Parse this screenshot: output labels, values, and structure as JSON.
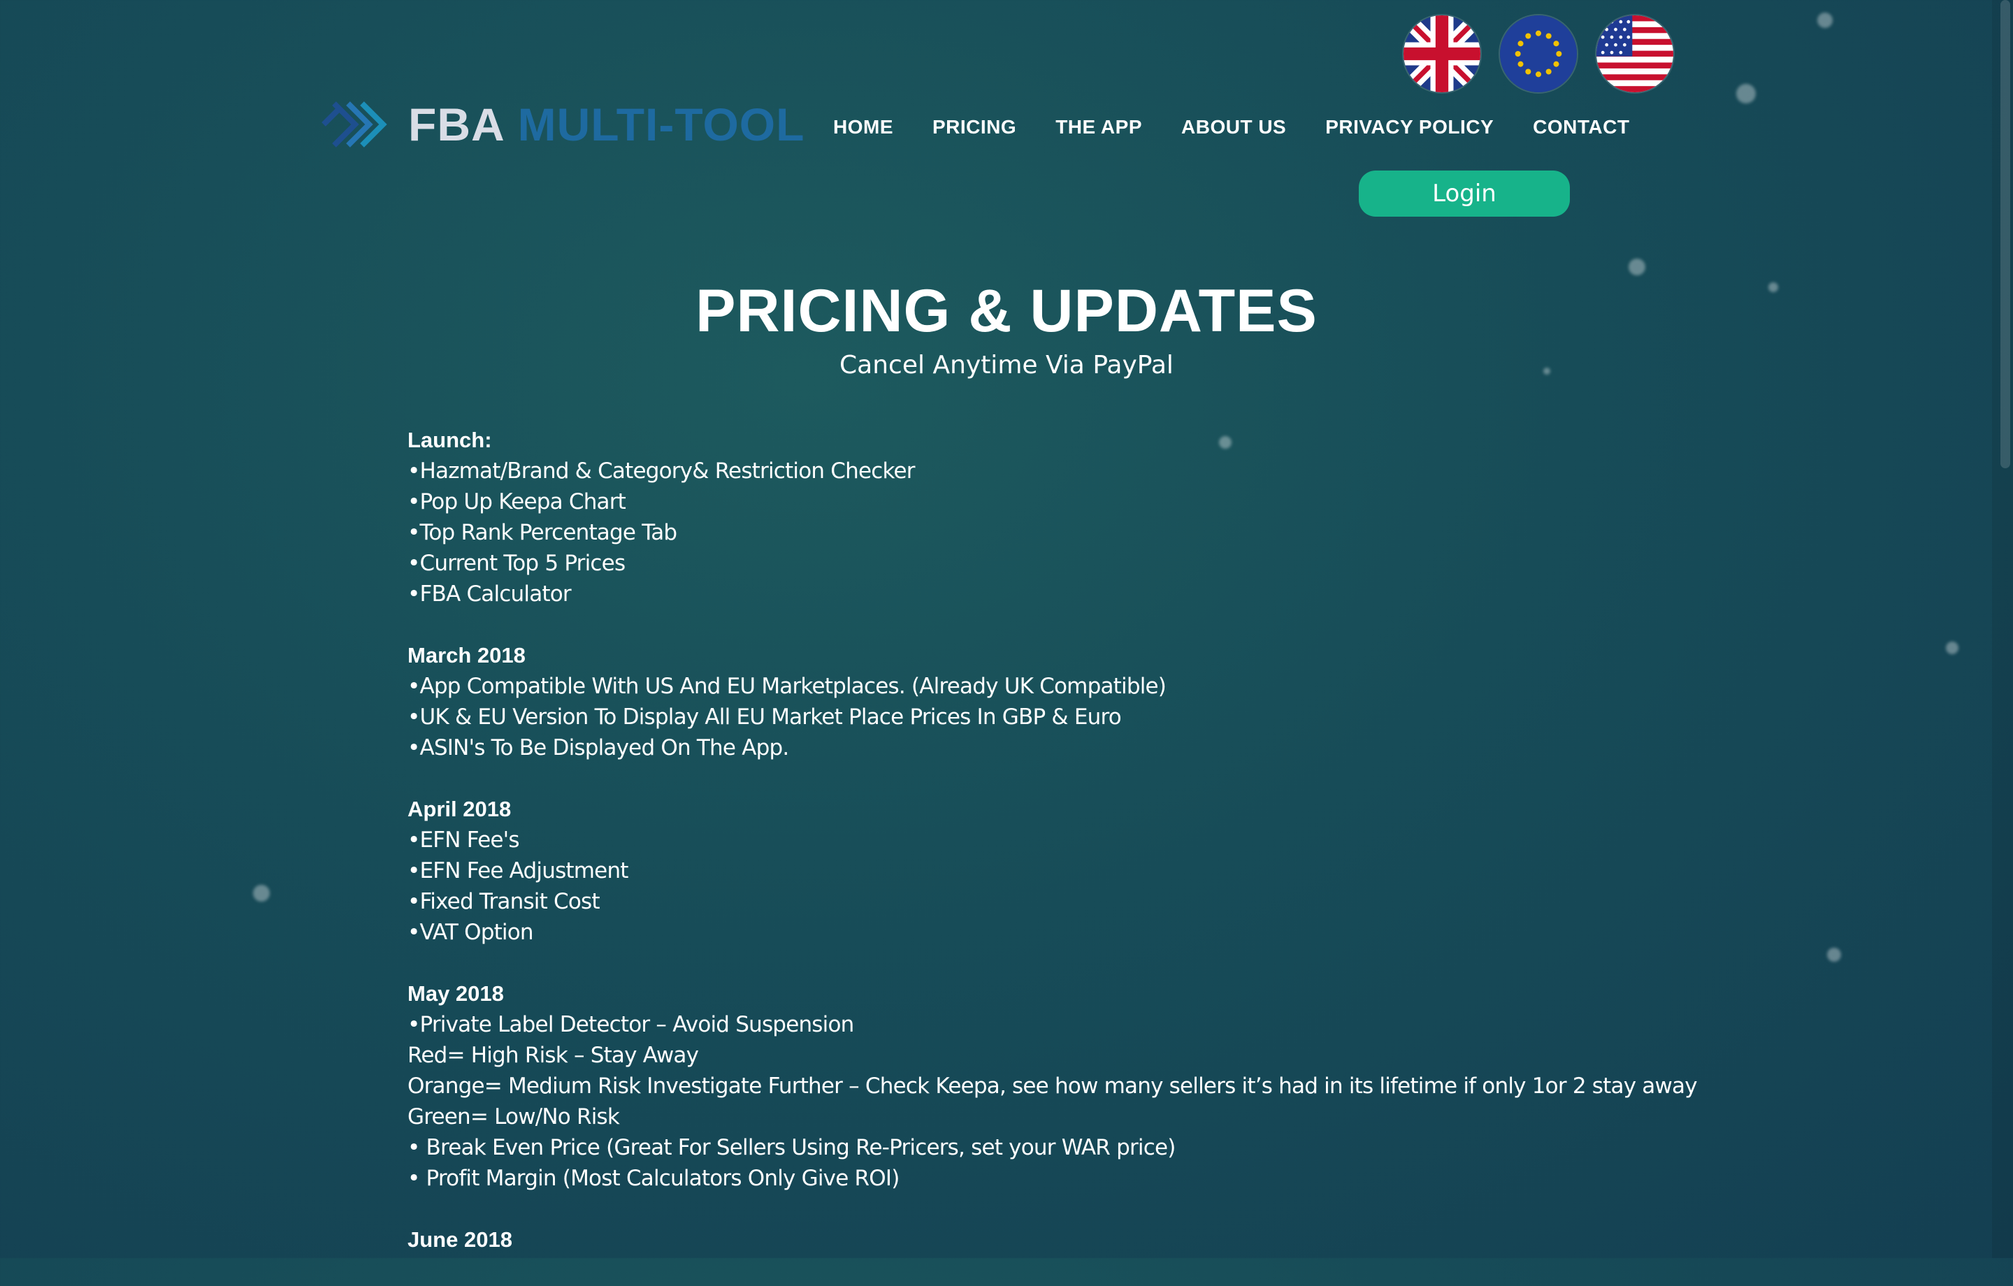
{
  "header": {
    "logo_part1": "FBA",
    "logo_part2": "MULTI-TOOL",
    "flags": [
      "uk-flag",
      "eu-flag",
      "us-flag"
    ],
    "nav": [
      "HOME",
      "PRICING",
      "THE APP",
      "ABOUT US",
      "PRIVACY POLICY",
      "CONTACT"
    ],
    "login_label": "Login"
  },
  "main": {
    "title": "PRICING & UPDATES",
    "subtitle": "Cancel Anytime Via PayPal",
    "sections": [
      {
        "heading": "Launch:",
        "lines": [
          "•Hazmat/Brand & Category& Restriction Checker",
          "•Pop Up Keepa Chart",
          "•Top Rank Percentage Tab",
          "•Current Top 5 Prices",
          "•FBA Calculator"
        ]
      },
      {
        "heading": "March 2018",
        "lines": [
          "•App Compatible With US And EU Marketplaces. (Already UK Compatible)",
          "•UK & EU Version To Display All EU Market Place Prices In GBP & Euro",
          "•ASIN's To Be Displayed On The App."
        ]
      },
      {
        "heading": "April 2018",
        "lines": [
          "•EFN Fee's",
          "•EFN Fee Adjustment",
          "•Fixed Transit Cost",
          "•VAT Option"
        ]
      },
      {
        "heading": "May 2018",
        "lines": [
          "•Private Label Detector – Avoid Suspension",
          "Red= High Risk – Stay Away",
          "Orange= Medium Risk Investigate Further – Check Keepa, see how many sellers it’s had in its lifetime if only 1or 2 stay away",
          "Green= Low/No Risk",
          "• Break Even Price (Great For Sellers Using Re-Pricers, set your WAR price)",
          "• Profit Margin (Most Calculators Only Give ROI)"
        ]
      },
      {
        "heading": "June 2018",
        "lines": []
      }
    ]
  },
  "colors": {
    "background": "#174c58",
    "login_button": "#17b38a",
    "logo_accent": "#1e6aa0"
  }
}
